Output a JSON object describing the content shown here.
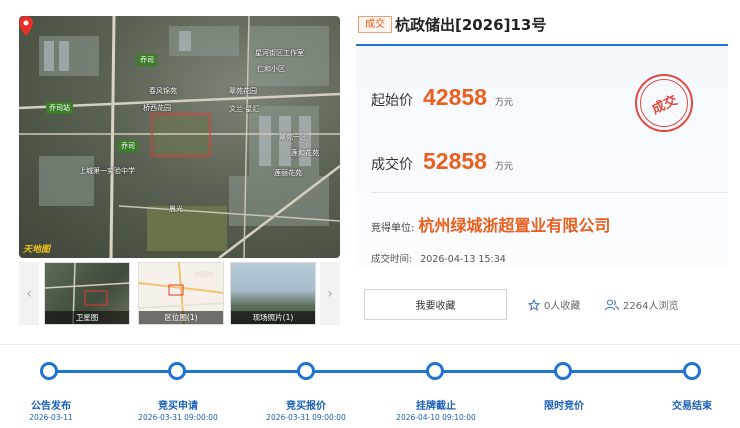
{
  "gallery": {
    "map_labels": [
      "香积",
      "星河街区工作室",
      "仁和小区",
      "春风锦苑",
      "翠苑花园",
      "桥西花园",
      "文兰·星汇",
      "中瑞",
      "杭州城市规划馆",
      "翠苑一区",
      "香积路",
      "仁和",
      "莲和花苑",
      "上城第一实验中学",
      "新竹区",
      "莲丽花苑",
      "晨光"
    ],
    "map_tags": [
      "乔司",
      "乔司站",
      "乔司"
    ],
    "watermark": "天地图",
    "thumbnails": [
      {
        "caption": "卫星图"
      },
      {
        "caption": "区位图(1)"
      },
      {
        "caption": "现场照片(1)"
      }
    ],
    "prev_icon": "chevron-left-icon",
    "next_icon": "chevron-right-icon"
  },
  "header": {
    "status": "成交",
    "title": "杭政储出[2026]13号"
  },
  "prices": {
    "start_label": "起始价",
    "start_value": "42858",
    "start_unit": "万元",
    "deal_label": "成交价",
    "deal_value": "52858",
    "deal_unit": "万元",
    "stamp": "成交"
  },
  "winner": {
    "label": "竞得单位:",
    "value": "杭州绿城浙超置业有限公司"
  },
  "deal_time": {
    "label": "成交时间:",
    "value": "2026-04-13 15:34"
  },
  "actions": {
    "favorite_button": "我要收藏",
    "favorites": "0人收藏",
    "views": "2264人浏览"
  },
  "timeline": {
    "steps": [
      {
        "label": "公告发布",
        "date": "2026-03-11"
      },
      {
        "label": "竞买申请",
        "date": "2026-03-31 09:00:00"
      },
      {
        "label": "竞买报价",
        "date": "2026-03-31 09:00:00"
      },
      {
        "label": "挂牌截止",
        "date": "2026-04-10 09:10:00"
      },
      {
        "label": "限时竞价",
        "date": ""
      },
      {
        "label": "交易结束",
        "date": ""
      }
    ]
  },
  "colors": {
    "accent_blue": "#1f73d2",
    "accent_orange": "#ea5f1e",
    "stamp_red": "#e04a3f"
  }
}
